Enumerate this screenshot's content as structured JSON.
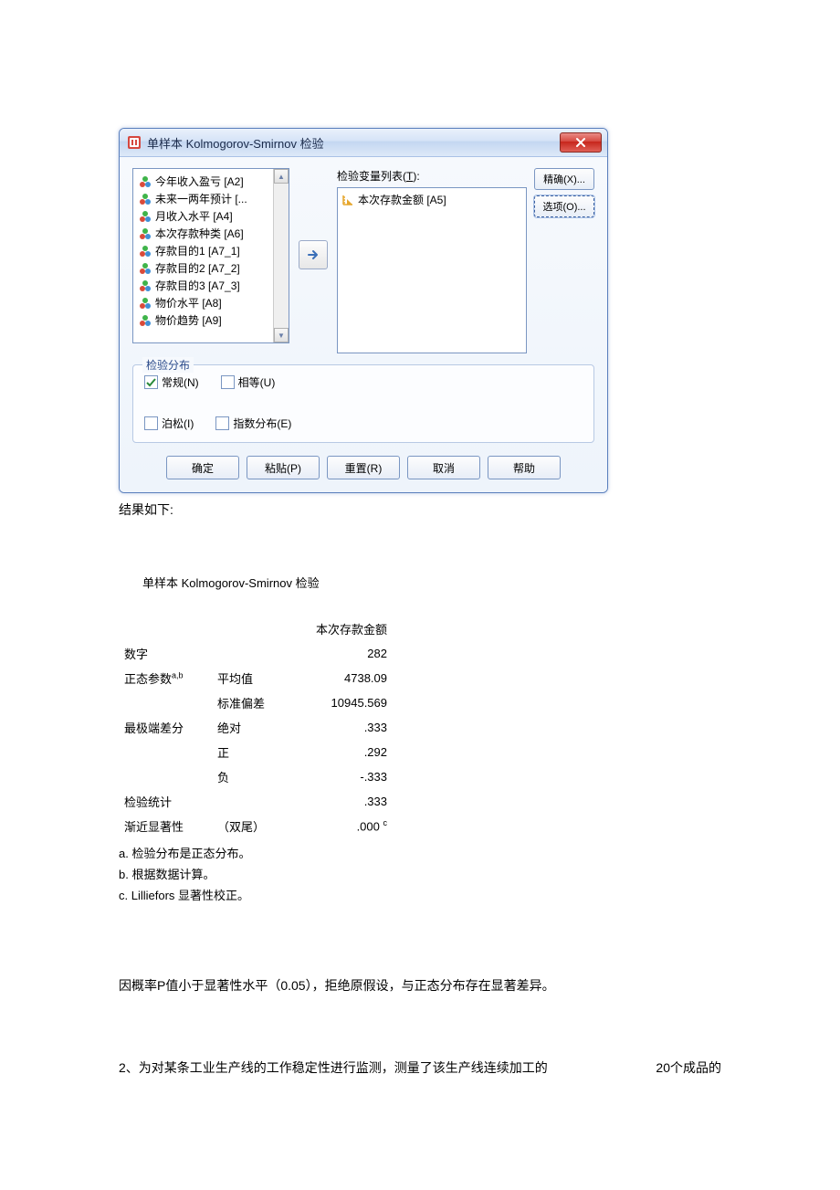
{
  "dialog": {
    "title": "单样本 Kolmogorov-Smirnov 检验",
    "var_list": [
      "今年收入盈亏 [A2]",
      "未来一两年预计 [...",
      "月收入水平 [A4]",
      "本次存款种类 [A6]",
      "存款目的1 [A7_1]",
      "存款目的2 [A7_2]",
      "存款目的3 [A7_3]",
      "物价水平 [A8]",
      "物价趋势 [A9]"
    ],
    "target_label_pre": "检验变量列表(",
    "target_label_ul": "T",
    "target_label_suf": "):",
    "target_item": "本次存款金额 [A5]",
    "side_buttons": {
      "exact": "精确(X)...",
      "options": "选项(O)..."
    },
    "group": {
      "title": "检验分布",
      "normal": "常规(N)",
      "uniform": "相等(U)",
      "poisson": "泊松(I)",
      "exponential": "指数分布(E)"
    },
    "buttons": {
      "ok": "确定",
      "paste": "粘贴(P)",
      "reset": "重置(R)",
      "cancel": "取消",
      "help": "帮助"
    }
  },
  "doc": {
    "result_label": "结果如下:",
    "stat_title": "单样本  Kolmogorov-Smirnov 检验",
    "col_header": "本次存款金额",
    "rows": {
      "n_label": "数字",
      "n_val": "282",
      "param_label": "正态参数",
      "param_sup": "a,b",
      "mean_label": "平均值",
      "mean_val": "4738.09",
      "sd_label": "标准偏差",
      "sd_val": "10945.569",
      "ext_label": "最极端差分",
      "abs_label": "绝对",
      "abs_val": ".333",
      "pos_label": "正",
      "pos_val": ".292",
      "neg_label": "负",
      "neg_val": "-.333",
      "ks_label": "检验统计",
      "ks_val": ".333",
      "sig_label": "渐近显著性",
      "sig_tail": "（双尾）",
      "sig_val": ".000",
      "sig_sup": "c"
    },
    "notes": {
      "a": "a.  检验分布是正态分布。",
      "b": "b.  根据数据计算。",
      "c": "c. Lilliefors 显著性校正。"
    },
    "conclusion": "因概率P值小于显著性水平（0.05），拒绝原假设，与正态分布存在显著差异。",
    "q2_left": "2、为对某条工业生产线的工作稳定性进行监测，测量了该生产线连续加工的",
    "q2_right": "20个成品的"
  }
}
